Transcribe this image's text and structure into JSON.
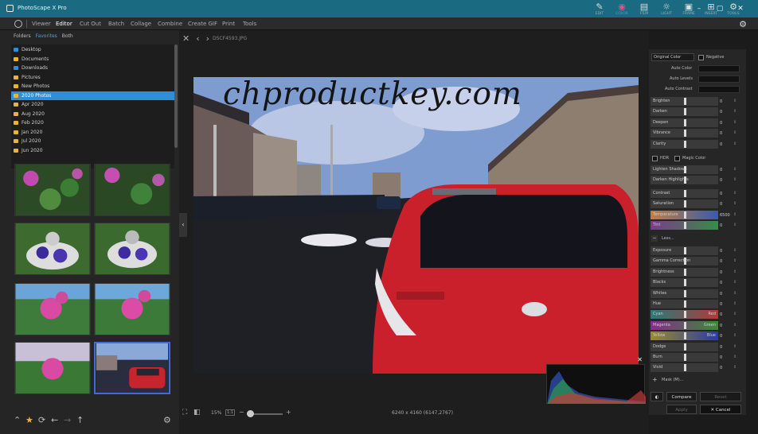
{
  "app": {
    "title": "PhotoScape X Pro",
    "min": "–",
    "max": "▢",
    "close": "✕"
  },
  "menu": {
    "items": [
      "Viewer",
      "Editor",
      "Cut Out",
      "Batch",
      "Collage",
      "Combine",
      "Create GIF",
      "Print",
      "Tools"
    ],
    "active": "Editor"
  },
  "left": {
    "tabs": [
      "Folders",
      "Favorites",
      "Both"
    ],
    "active_tab": "Favorites",
    "folders": [
      {
        "label": "Desktop",
        "color": "blue"
      },
      {
        "label": "Documents",
        "color": "yellow"
      },
      {
        "label": "Downloads",
        "color": "blue"
      },
      {
        "label": "Pictures",
        "color": "yellow"
      },
      {
        "label": "New Photos",
        "color": "yellow"
      },
      {
        "label": "2020 Photos",
        "color": "yellow",
        "selected": true
      },
      {
        "label": "Apr 2020",
        "color": "yellow"
      },
      {
        "label": "Aug 2020",
        "color": "yellow"
      },
      {
        "label": "Feb 2020",
        "color": "yellow"
      },
      {
        "label": "Jan 2020",
        "color": "yellow"
      },
      {
        "label": "Jul 2020",
        "color": "yellow"
      },
      {
        "label": "Jun 2020",
        "color": "yellow"
      }
    ]
  },
  "viewer": {
    "filename": "DSCF4593.JPG",
    "zoom": "15%",
    "ratio": "1:1",
    "dimensions": "6240 x 4160 (6147,2767)",
    "watermark": "chproductkey.com"
  },
  "toolbar": [
    {
      "label": "EDIT",
      "icon": "edit-icon",
      "glyph": "✎"
    },
    {
      "label": "COLOR",
      "icon": "color-wheel-icon",
      "glyph": "◉",
      "active": true
    },
    {
      "label": "FILM",
      "icon": "film-icon",
      "glyph": "▤"
    },
    {
      "label": "LIGHT",
      "icon": "light-icon",
      "glyph": "☼"
    },
    {
      "label": "FRAME",
      "icon": "frame-icon",
      "glyph": "▣"
    },
    {
      "label": "INSERT",
      "icon": "insert-icon",
      "glyph": "⊞"
    },
    {
      "label": "TOOLS",
      "icon": "tools-icon",
      "glyph": "⚙"
    }
  ],
  "panel": {
    "dropdown": "Original Color",
    "negative": "Negative",
    "auto": [
      "Auto Color",
      "Auto Levels",
      "Auto Contrast"
    ],
    "group1": [
      {
        "label": "Brighten",
        "value": "0"
      },
      {
        "label": "Darken",
        "value": "0"
      },
      {
        "label": "Deepen",
        "value": "0"
      },
      {
        "label": "Vibrance",
        "value": "0"
      },
      {
        "label": "Clarity",
        "value": "0"
      }
    ],
    "hdr": "HDR",
    "magic": "Magic Color",
    "group2": [
      {
        "label": "Lighten Shadows",
        "value": "0"
      },
      {
        "label": "Darken Highlights",
        "value": "0"
      }
    ],
    "group3": [
      {
        "label": "Contrast",
        "value": "0"
      },
      {
        "label": "Saturation",
        "value": "0"
      },
      {
        "label": "Temperature",
        "value": "6500"
      },
      {
        "label": "Tint",
        "value": "0"
      }
    ],
    "less": "Less...",
    "group4": [
      {
        "label": "Exposure",
        "value": "0"
      },
      {
        "label": "Gamma Correction",
        "value": "0"
      },
      {
        "label": "Brightness",
        "value": "0"
      },
      {
        "label": "Blacks",
        "value": "0"
      },
      {
        "label": "Whites",
        "value": "0"
      },
      {
        "label": "Hue",
        "value": "0"
      },
      {
        "label": "Cyan",
        "right": "Red",
        "value": "0"
      },
      {
        "label": "Magenta",
        "right": "Green",
        "value": "0"
      },
      {
        "label": "Yellow",
        "right": "Blue",
        "value": "0"
      },
      {
        "label": "Dodge",
        "value": "0"
      },
      {
        "label": "Burn",
        "value": "0"
      },
      {
        "label": "Vivid",
        "value": "0"
      }
    ],
    "mask": "Mask (M)...",
    "compare": "Compare",
    "reset": "Reset",
    "apply": "Apply",
    "cancel": "Cancel"
  },
  "colors": {
    "titlebar": "#1a6a82",
    "accent": "#4aa3d8",
    "selection": "#2d8fd8"
  }
}
